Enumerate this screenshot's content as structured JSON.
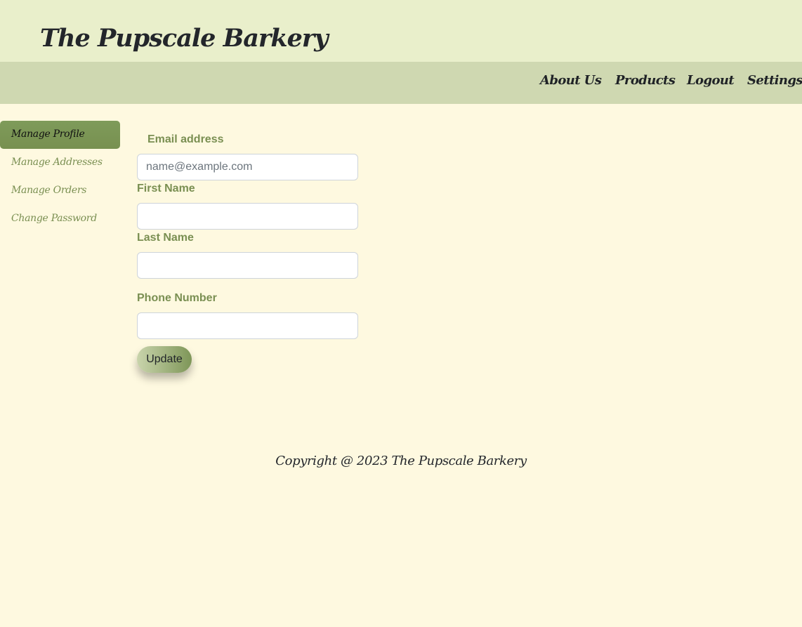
{
  "header": {
    "title": "The Pupscale Barkery"
  },
  "nav": {
    "items": [
      "About Us",
      "Products",
      "Logout",
      "Settings"
    ]
  },
  "sidebar": {
    "items": [
      {
        "label": "Manage Profile",
        "active": true
      },
      {
        "label": "Manage Addresses",
        "active": false
      },
      {
        "label": "Manage Orders",
        "active": false
      },
      {
        "label": "Change Password",
        "active": false
      }
    ]
  },
  "form": {
    "email": {
      "label": "Email address",
      "placeholder": "name@example.com",
      "value": ""
    },
    "first_name": {
      "label": "First Name",
      "value": ""
    },
    "last_name": {
      "label": "Last Name",
      "value": ""
    },
    "phone": {
      "label": "Phone Number",
      "value": ""
    },
    "submit_label": "Update"
  },
  "footer": {
    "text": "Copyright @ 2023 The Pupscale Barkery"
  },
  "colors": {
    "header_bg": "#e9efcb",
    "nav_bg": "#cfd8b1",
    "page_bg": "#fef9e0",
    "accent": "#7a8f52"
  }
}
